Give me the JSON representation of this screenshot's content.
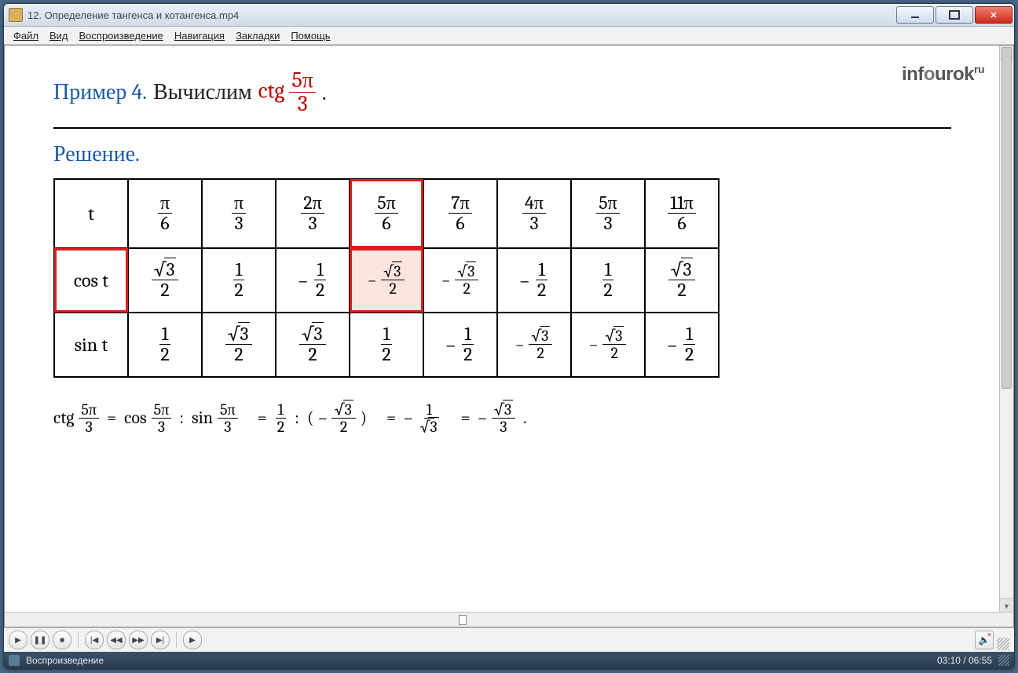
{
  "window": {
    "title": "12. Определение тангенса и котангенса.mp4"
  },
  "menu": {
    "file": "Файл",
    "view": "Вид",
    "play": "Воспроизведение",
    "nav": "Навигация",
    "bookmarks": "Закладки",
    "help": "Помощь"
  },
  "logo": {
    "brand": "inf",
    "mid": "o",
    "tail": "urok",
    "sup": "ru"
  },
  "example": {
    "number": "Пример 4.",
    "verb": "Вычислим",
    "func": "ctg",
    "arg_num": "5π",
    "arg_den": "3",
    "period": "."
  },
  "solution_heading": "Решение.",
  "table": {
    "rows": [
      {
        "label": "t",
        "cells": [
          {
            "num": "π",
            "den": "6"
          },
          {
            "num": "π",
            "den": "3"
          },
          {
            "num": "2π",
            "den": "3"
          },
          {
            "num": "5π",
            "den": "6",
            "hl": true
          },
          {
            "num": "7π",
            "den": "6"
          },
          {
            "num": "4π",
            "den": "3"
          },
          {
            "num": "5π",
            "den": "3"
          },
          {
            "num": "11π",
            "den": "6"
          }
        ]
      },
      {
        "label": "cos t",
        "label_hl": true,
        "cells": [
          {
            "num": "√3",
            "den": "2",
            "sqrt": true
          },
          {
            "num": "1",
            "den": "2"
          },
          {
            "neg": true,
            "num": "1",
            "den": "2"
          },
          {
            "neg": true,
            "num": "√3",
            "den": "2",
            "sqrt": true,
            "hl": true,
            "fill": true,
            "sm": true
          },
          {
            "neg": true,
            "num": "√3",
            "den": "2",
            "sqrt": true,
            "sm": true
          },
          {
            "neg": true,
            "num": "1",
            "den": "2"
          },
          {
            "num": "1",
            "den": "2"
          },
          {
            "num": "√3",
            "den": "2",
            "sqrt": true
          }
        ]
      },
      {
        "label": "sin t",
        "cells": [
          {
            "num": "1",
            "den": "2"
          },
          {
            "num": "√3",
            "den": "2",
            "sqrt": true
          },
          {
            "num": "√3",
            "den": "2",
            "sqrt": true
          },
          {
            "num": "1",
            "den": "2"
          },
          {
            "neg": true,
            "num": "1",
            "den": "2"
          },
          {
            "neg": true,
            "num": "√3",
            "den": "2",
            "sqrt": true,
            "sm": true
          },
          {
            "neg": true,
            "num": "√3",
            "den": "2",
            "sqrt": true,
            "sm": true
          },
          {
            "neg": true,
            "num": "1",
            "den": "2"
          }
        ]
      }
    ]
  },
  "derivation": {
    "lhs_func": "ctg",
    "lhs_num": "5π",
    "lhs_den": "3",
    "cos": "cos",
    "sin": "sin",
    "eq": "=",
    "colon": ":",
    "arg_num": "5π",
    "arg_den": "3",
    "half_num": "1",
    "half_den": "2",
    "neg": "–",
    "open": "(",
    "close": ")",
    "r3_num": "√3",
    "r3_den": "2",
    "inv_num": "1",
    "inv_den": "√3",
    "ans_num": "√3",
    "ans_den": "3",
    "period": "."
  },
  "status": {
    "state": "Воспроизведение",
    "time": "03:10 / 06:55"
  }
}
